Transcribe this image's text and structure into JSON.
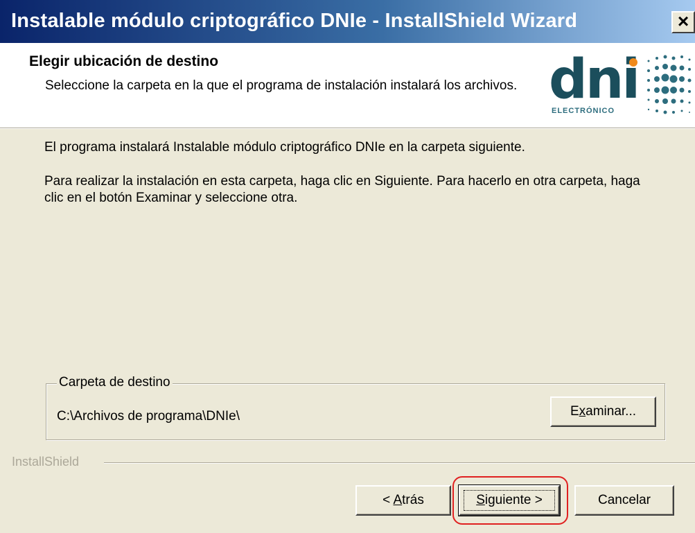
{
  "window": {
    "title": "Instalable módulo criptográfico DNIe - InstallShield Wizard",
    "close_glyph": "×"
  },
  "header": {
    "title": "Elegir ubicación de destino",
    "subtitle": "Seleccione la carpeta en la que el programa de instalación instalará los archivos.",
    "logo_word": "dni",
    "logo_sub": "ELECTRÓNICO"
  },
  "body": {
    "line1": "El programa instalará Instalable módulo criptográfico DNIe en la carpeta siguiente.",
    "line2": "Para realizar la instalación en esta carpeta, haga clic en Siguiente. Para hacerlo en otra carpeta, haga clic en el botón Examinar y seleccione otra."
  },
  "destination": {
    "legend": "Carpeta de destino",
    "path": "C:\\Archivos de programa\\DNIe\\",
    "browse_pre": "E",
    "browse_mnemonic": "x",
    "browse_post": "aminar..."
  },
  "footer": {
    "brand": "InstallShield"
  },
  "buttons": {
    "back_pre": "< ",
    "back_mnemonic": "A",
    "back_post": "trás",
    "next_pre": "",
    "next_mnemonic": "S",
    "next_post": "iguiente >",
    "cancel": "Cancelar"
  },
  "colors": {
    "titlebar_start": "#0a246a",
    "titlebar_end": "#a6caf0",
    "highlight": "#e02020",
    "logo_primary": "#1b4e5c",
    "logo_accent": "#f08a1c"
  }
}
